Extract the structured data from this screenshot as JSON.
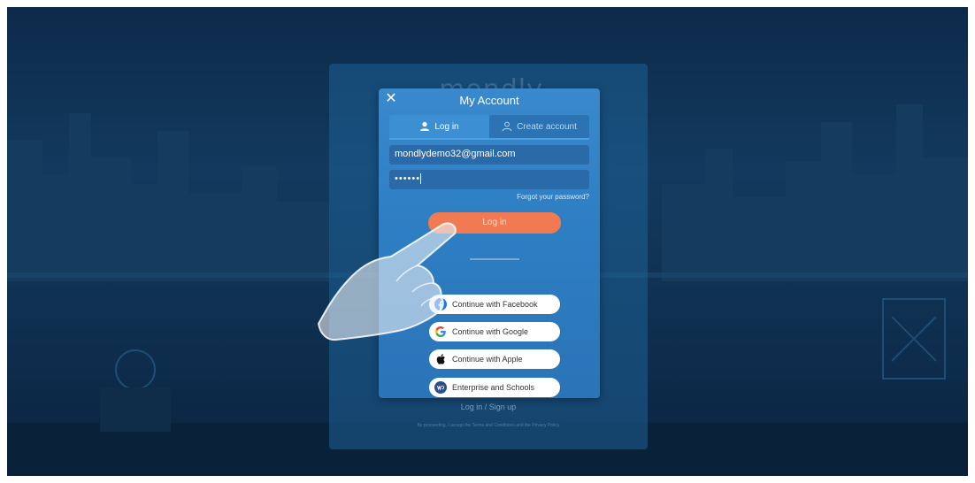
{
  "brand": {
    "ghost_text": "mondly"
  },
  "modal": {
    "title": "My Account",
    "close_symbol": "✕",
    "tabs": [
      {
        "label": "Log in",
        "icon": "user-icon",
        "active": true
      },
      {
        "label": "Create account",
        "icon": "user-outline-icon",
        "active": false
      }
    ],
    "email_value": "mondlydemo32@gmail.com",
    "password_value": "••••••",
    "forgot_label": "Forgot your password?",
    "login_label": "Log in",
    "social_buttons": [
      {
        "label": "Continue with Facebook",
        "icon": "facebook-icon"
      },
      {
        "label": "Continue with Google",
        "icon": "google-icon"
      },
      {
        "label": "Continue with Apple",
        "icon": "apple-icon"
      },
      {
        "label": "Enterprise and Schools",
        "icon": "enterprise-icon"
      }
    ]
  },
  "footer": {
    "links": "Log in  /  Sign up",
    "terms": "By proceeding, I accept the Terms and Conditions and the Privacy Policy"
  },
  "colors": {
    "background": "#0d2a4a",
    "modal": "#2f7fc4",
    "login_button": "#f17a52",
    "facebook": "#1877f2",
    "enterprise": "#2d4f8e"
  }
}
